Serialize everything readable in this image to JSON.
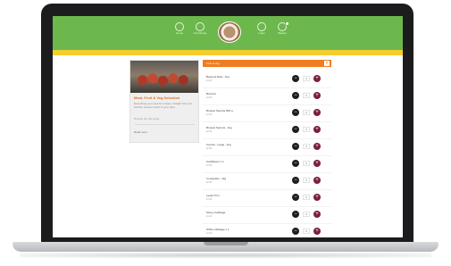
{
  "site": {
    "accent_green": "#6cb84c",
    "accent_yellow": "#f5cd2e",
    "accent_orange": "#f07c22"
  },
  "nav": {
    "items": [
      {
        "label": "Home",
        "icon": "home-icon"
      },
      {
        "label": "Our Range",
        "icon": "range-icon"
      },
      {
        "label": "Login",
        "icon": "user-icon"
      },
      {
        "label": "Basket",
        "icon": "basket-icon"
      }
    ],
    "logo_icon": "butcher-logo"
  },
  "promo_card": {
    "title": "Meat, Fruit & Veg Selection",
    "description": "Everything you need for a feast, straight from our butcher counter, fresh to your door.",
    "link_text": "Browse our full range",
    "footer_text": "Read more"
  },
  "products_panel": {
    "title": "Fruit & Veg",
    "close_label": "×",
    "minus_label": "−",
    "plus_label": "+",
    "items": [
      {
        "name": "Beetroot Raw - 1kg",
        "price": "£1.20",
        "qty": "0"
      },
      {
        "name": "Broccoli",
        "price": "£1.00",
        "qty": "0"
      },
      {
        "name": "Brussel Sprouts 500 g",
        "price": "£1.20",
        "qty": "0"
      },
      {
        "name": "Brussel Sprouts - 1kg",
        "price": "£2.00",
        "qty": "0"
      },
      {
        "name": "Carrots - Large - 1kg",
        "price": "£0.90",
        "qty": "0"
      },
      {
        "name": "Cauliflower x 1",
        "price": "£1.50",
        "qty": "0"
      },
      {
        "name": "Courgettes - 1kg",
        "price": "£2.50",
        "qty": "0"
      },
      {
        "name": "Leeks Trim",
        "price": "£1.00",
        "qty": "0"
      },
      {
        "name": "Savoy Cabbage",
        "price": "£1.20",
        "qty": "0"
      },
      {
        "name": "White Cabbage x 1",
        "price": "£1.00",
        "qty": "0"
      },
      {
        "name": "Red Cabbage x 1",
        "price": "£1.00",
        "qty": "0"
      }
    ]
  }
}
